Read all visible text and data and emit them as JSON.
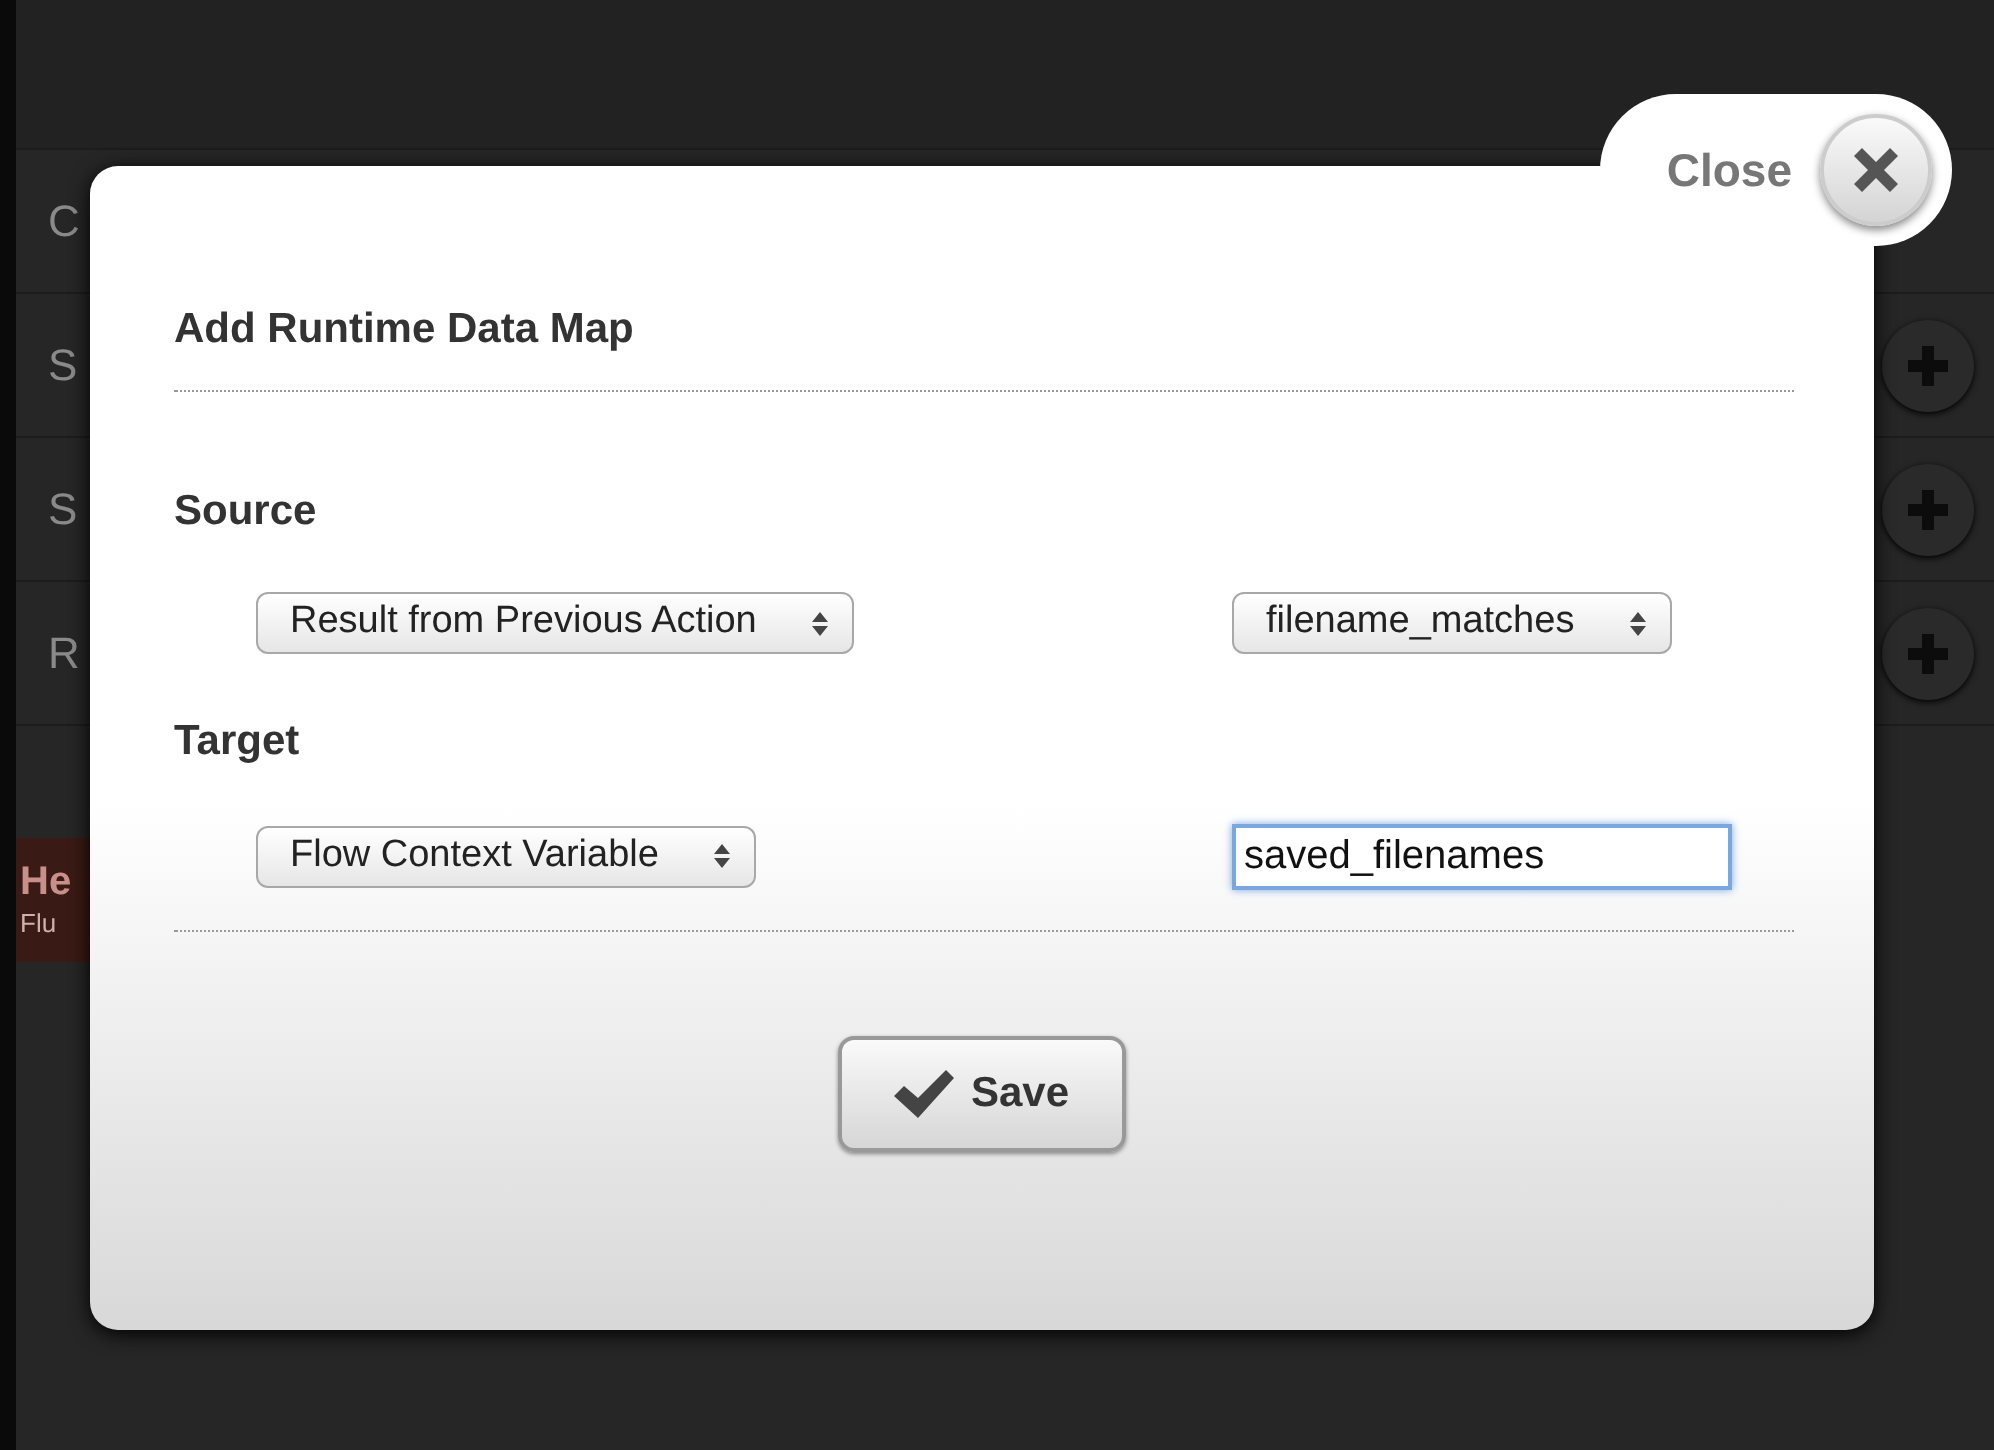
{
  "background": {
    "rows": [
      {
        "label": "C",
        "has_add": false
      },
      {
        "label": "S",
        "has_add": true
      },
      {
        "label": "S",
        "has_add": true
      },
      {
        "label": "R",
        "has_add": true
      }
    ],
    "banner": {
      "title": "He",
      "subtitle": "Flu"
    }
  },
  "dialog": {
    "close_label": "Close",
    "title": "Add Runtime Data Map",
    "sections": [
      {
        "heading": "Source",
        "fields": [
          {
            "kind": "select",
            "value": "Result from Previous Action"
          },
          {
            "kind": "select",
            "value": "filename_matches"
          }
        ]
      },
      {
        "heading": "Target",
        "fields": [
          {
            "kind": "select",
            "value": "Flow Context Variable"
          },
          {
            "kind": "text",
            "value": "saved_filenames",
            "focused": true
          }
        ]
      }
    ],
    "save_label": "Save"
  }
}
